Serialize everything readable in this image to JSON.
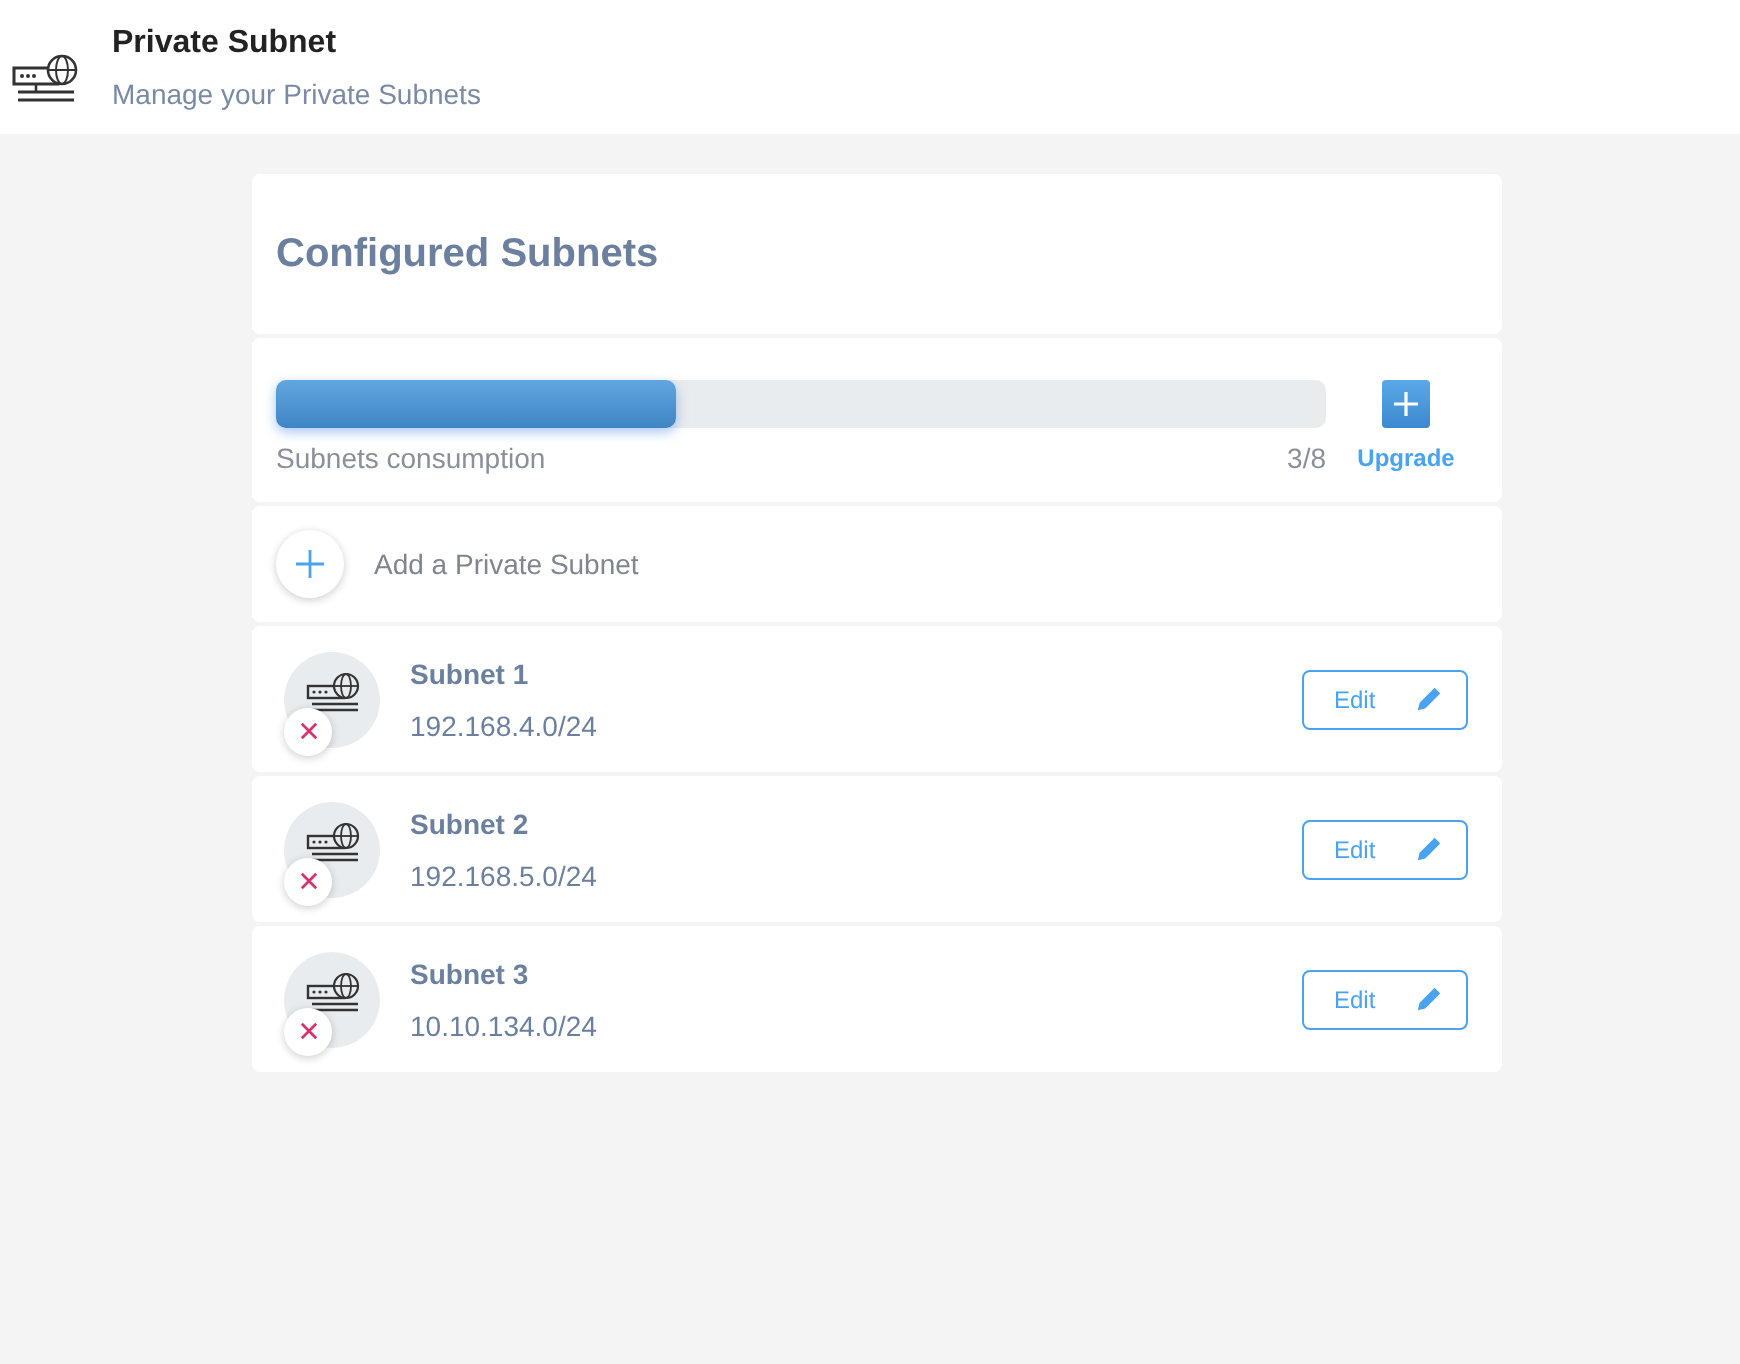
{
  "header": {
    "title": "Private Subnet",
    "subtitle": "Manage your Private Subnets"
  },
  "section_title": "Configured Subnets",
  "consumption": {
    "level": 0.38,
    "label": "Subnets consumption",
    "reading": "3/8",
    "upgrade_label": "Upgrade"
  },
  "add_label": "Add a Private Subnet",
  "subnets": [
    {
      "name": "Subnet 1",
      "cidr": "192.168.4.0/24",
      "edit_label": "Edit"
    },
    {
      "name": "Subnet 2",
      "cidr": "192.168.5.0/24",
      "edit_label": "Edit"
    },
    {
      "name": "Subnet 3",
      "cidr": "10.10.134.0/24",
      "edit_label": "Edit"
    }
  ]
}
